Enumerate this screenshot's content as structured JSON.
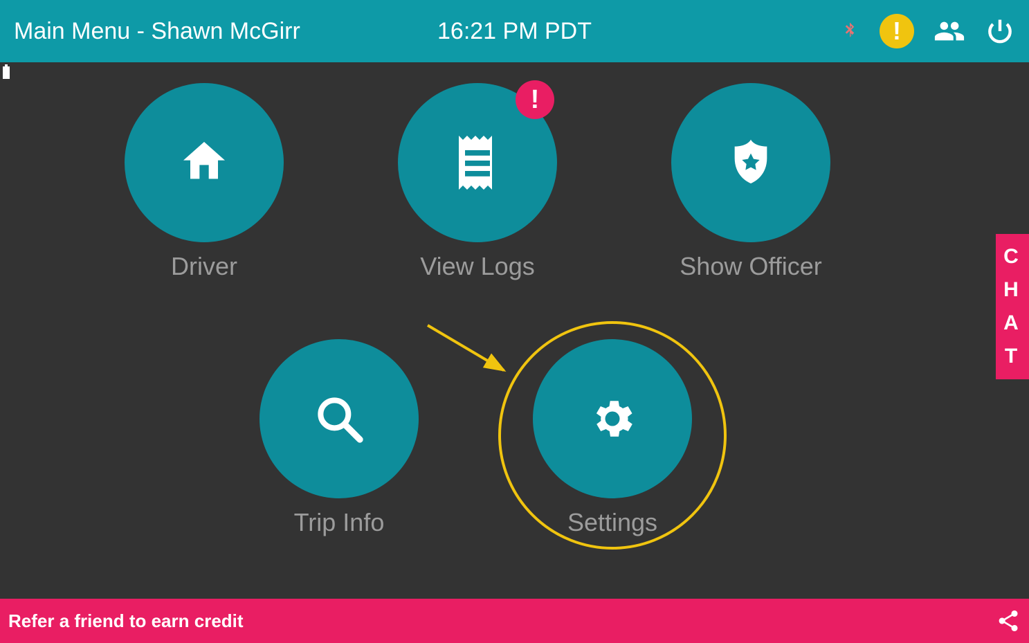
{
  "topbar": {
    "title": "Main Menu - Shawn McGirr",
    "clock": "16:21 PM PDT"
  },
  "menu": {
    "driver": {
      "label": "Driver",
      "icon": "home-icon"
    },
    "view_logs": {
      "label": "View Logs",
      "icon": "receipt-icon",
      "alert": "!"
    },
    "show_officer": {
      "label": "Show Officer",
      "icon": "badge-icon"
    },
    "trip_info": {
      "label": "Trip Info",
      "icon": "search-icon"
    },
    "settings": {
      "label": "Settings",
      "icon": "gear-icon"
    }
  },
  "chat_tab": {
    "letters": [
      "C",
      "H",
      "A",
      "T"
    ]
  },
  "bottombar": {
    "refer": "Refer a friend to earn credit"
  },
  "annotation": {
    "highlighted": "settings",
    "arrow_color": "#f0c40f"
  },
  "colors": {
    "accent": "#0e9aa7",
    "circle": "#0e8d9b",
    "pink": "#e91e63",
    "yellow": "#f0c40f",
    "bg": "#333333"
  }
}
